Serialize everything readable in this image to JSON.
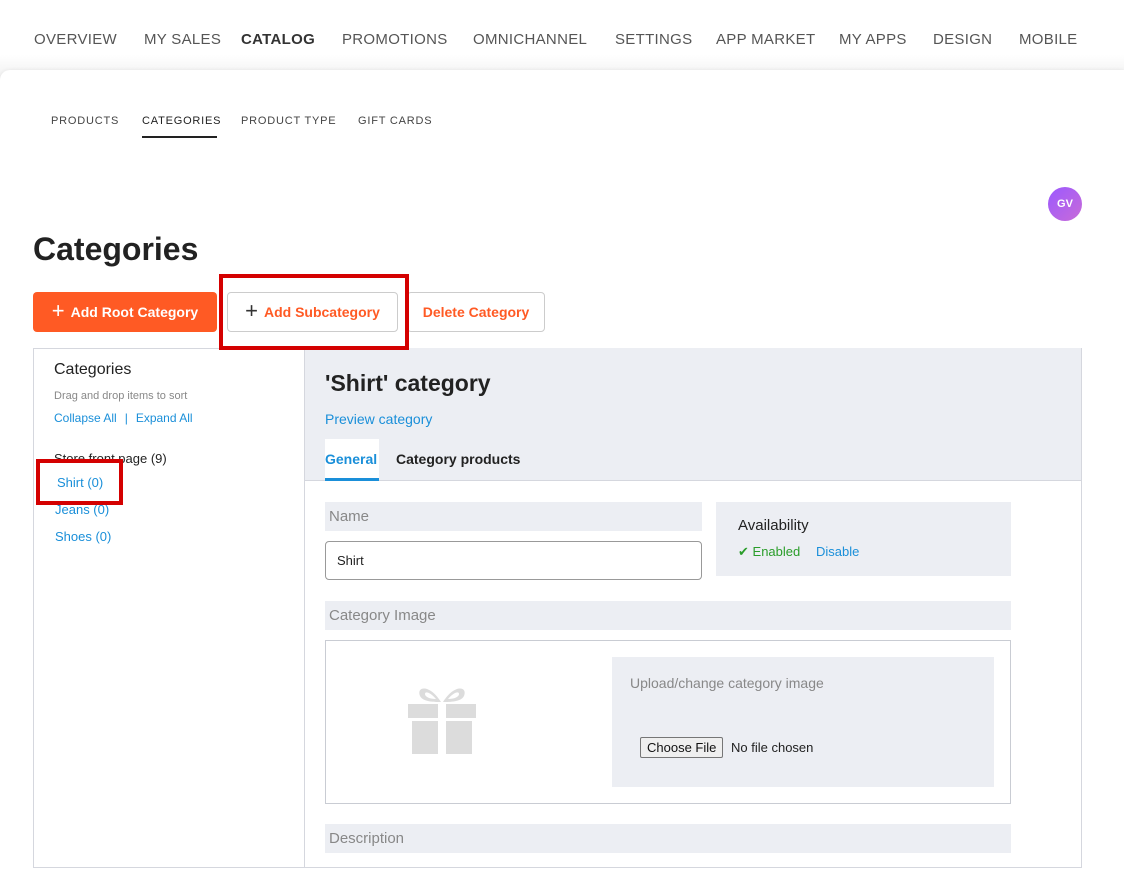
{
  "top_nav": [
    {
      "label": "OVERVIEW",
      "active": false
    },
    {
      "label": "MY SALES",
      "active": false
    },
    {
      "label": "CATALOG",
      "active": true
    },
    {
      "label": "PROMOTIONS",
      "active": false
    },
    {
      "label": "OMNICHANNEL",
      "active": false
    },
    {
      "label": "SETTINGS",
      "active": false
    },
    {
      "label": "APP MARKET",
      "active": false
    },
    {
      "label": "MY APPS",
      "active": false
    },
    {
      "label": "DESIGN",
      "active": false
    },
    {
      "label": "MOBILE",
      "active": false
    }
  ],
  "sub_tabs": [
    {
      "label": "PRODUCTS",
      "active": false
    },
    {
      "label": "CATEGORIES",
      "active": true
    },
    {
      "label": "PRODUCT TYPE",
      "active": false
    },
    {
      "label": "GIFT CARDS",
      "active": false
    }
  ],
  "user": {
    "initials": "GV"
  },
  "page": {
    "title": "Categories"
  },
  "actions": {
    "add_root": "Add Root Category",
    "add_sub": "Add Subcategory",
    "delete": "Delete Category"
  },
  "sidebar": {
    "title": "Categories",
    "hint": "Drag and drop items to sort",
    "collapse_all": "Collapse All",
    "separator": "|",
    "expand_all": "Expand All",
    "root": "Store front page (9)",
    "items": [
      {
        "label": "Shirt (0)"
      },
      {
        "label": "Jeans (0)"
      },
      {
        "label": "Shoes (0)"
      }
    ]
  },
  "category": {
    "title": "'Shirt' category",
    "preview_link": "Preview category",
    "tabs": [
      {
        "label": "General",
        "active": true
      },
      {
        "label": "Category products",
        "active": false
      }
    ],
    "name_label": "Name",
    "name_value": "Shirt",
    "availability": {
      "title": "Availability",
      "status": "Enabled",
      "disable": "Disable"
    },
    "image_label": "Category Image",
    "upload_label": "Upload/change category image",
    "choose_file": "Choose File",
    "file_status": "No file chosen",
    "description_label": "Description"
  },
  "colors": {
    "accent": "#ff5a24",
    "link": "#1a8fd9",
    "highlight": "#d40000",
    "enabled": "#2a9d2a"
  },
  "icons": [
    "plus-icon",
    "checkmark-icon",
    "gift-icon"
  ]
}
